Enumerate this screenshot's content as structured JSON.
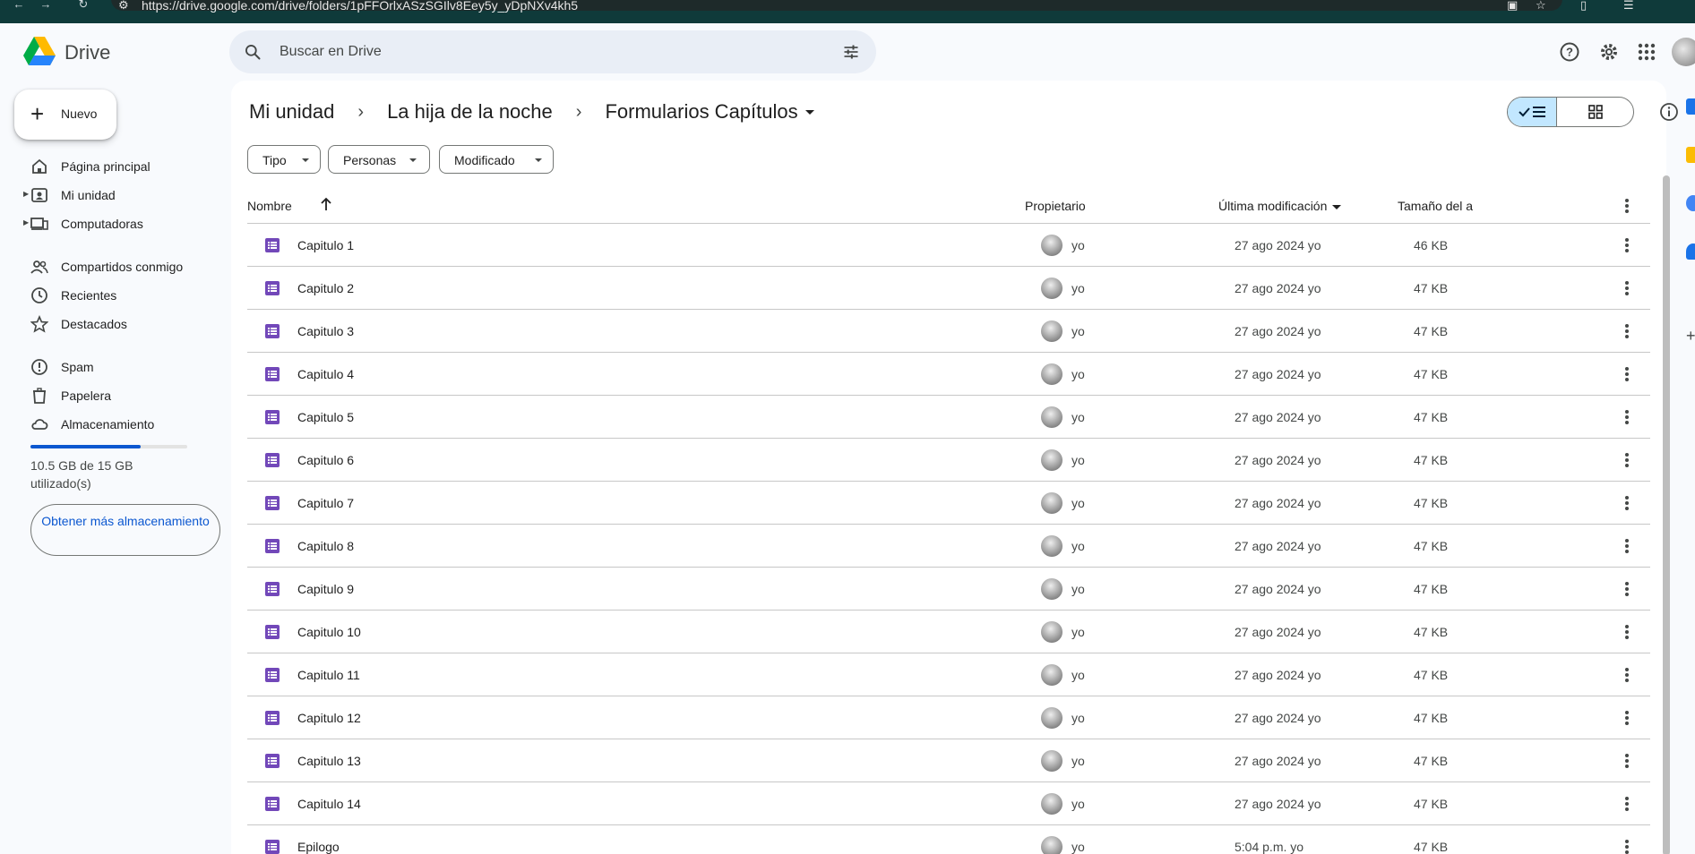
{
  "browser": {
    "url": "https://drive.google.com/drive/folders/1pFFOrlxASzSGIlv8Eey5y_yDpNXv4kh5"
  },
  "app": {
    "name": "Drive",
    "search_placeholder": "Buscar en Drive"
  },
  "sidebar": {
    "new_label": "Nuevo",
    "items": [
      {
        "label": "Página principal",
        "icon": "home-icon"
      },
      {
        "label": "Mi unidad",
        "icon": "my-drive-icon"
      },
      {
        "label": "Computadoras",
        "icon": "computer-icon"
      },
      {
        "label": "Compartidos conmigo",
        "icon": "shared-icon"
      },
      {
        "label": "Recientes",
        "icon": "clock-icon"
      },
      {
        "label": "Destacados",
        "icon": "star-icon"
      },
      {
        "label": "Spam",
        "icon": "spam-icon"
      },
      {
        "label": "Papelera",
        "icon": "trash-icon"
      },
      {
        "label": "Almacenamiento",
        "icon": "cloud-icon"
      }
    ],
    "storage_text": "10.5 GB de 15 GB utilizado(s)",
    "storage_fraction": 0.7,
    "get_more_storage": "Obtener más almacenamiento"
  },
  "breadcrumb": [
    "Mi unidad",
    "La hija de la noche",
    "Formularios Capítulos"
  ],
  "filters": [
    "Tipo",
    "Personas",
    "Modificado"
  ],
  "columns": {
    "name": "Nombre",
    "owner": "Propietario",
    "modified": "Última modificación",
    "size": "Tamaño del a"
  },
  "files": [
    {
      "name": "Capitulo 1",
      "owner": "yo",
      "modified": "27 ago 2024 yo",
      "size": "46 KB"
    },
    {
      "name": "Capitulo 2",
      "owner": "yo",
      "modified": "27 ago 2024 yo",
      "size": "47 KB"
    },
    {
      "name": "Capitulo 3",
      "owner": "yo",
      "modified": "27 ago 2024 yo",
      "size": "47 KB"
    },
    {
      "name": "Capitulo 4",
      "owner": "yo",
      "modified": "27 ago 2024 yo",
      "size": "47 KB"
    },
    {
      "name": "Capitulo 5",
      "owner": "yo",
      "modified": "27 ago 2024 yo",
      "size": "47 KB"
    },
    {
      "name": "Capitulo 6",
      "owner": "yo",
      "modified": "27 ago 2024 yo",
      "size": "47 KB"
    },
    {
      "name": "Capitulo 7",
      "owner": "yo",
      "modified": "27 ago 2024 yo",
      "size": "47 KB"
    },
    {
      "name": "Capitulo 8",
      "owner": "yo",
      "modified": "27 ago 2024 yo",
      "size": "47 KB"
    },
    {
      "name": "Capitulo 9",
      "owner": "yo",
      "modified": "27 ago 2024 yo",
      "size": "47 KB"
    },
    {
      "name": "Capitulo 10",
      "owner": "yo",
      "modified": "27 ago 2024 yo",
      "size": "47 KB"
    },
    {
      "name": "Capitulo 11",
      "owner": "yo",
      "modified": "27 ago 2024 yo",
      "size": "47 KB"
    },
    {
      "name": "Capitulo 12",
      "owner": "yo",
      "modified": "27 ago 2024 yo",
      "size": "47 KB"
    },
    {
      "name": "Capitulo 13",
      "owner": "yo",
      "modified": "27 ago 2024 yo",
      "size": "47 KB"
    },
    {
      "name": "Capitulo 14",
      "owner": "yo",
      "modified": "27 ago 2024 yo",
      "size": "47 KB"
    },
    {
      "name": "Epilogo",
      "owner": "yo",
      "modified": "5:04 p.m. yo",
      "size": "47 KB"
    }
  ],
  "colors": {
    "accent": "#0b57d0",
    "forms_icon": "#7248b9",
    "selected_toggle": "#c2e7ff",
    "surface": "#f8fafd"
  }
}
